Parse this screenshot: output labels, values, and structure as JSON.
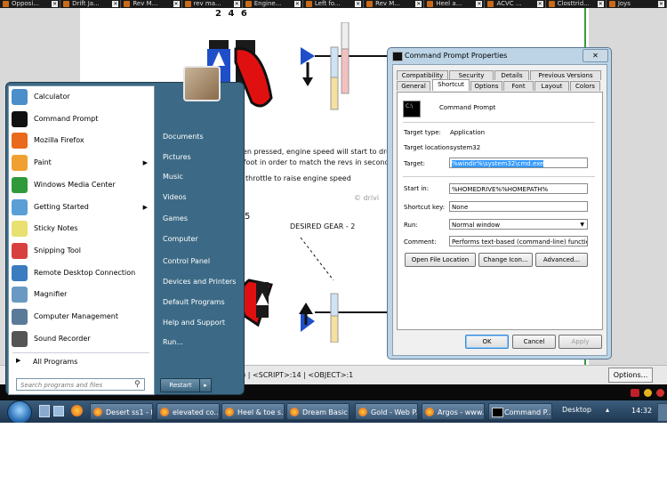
{
  "browser_tabs": [
    {
      "label": "Opposi..."
    },
    {
      "label": "Drift Ja..."
    },
    {
      "label": "Rev M..."
    },
    {
      "label": "rev ma..."
    },
    {
      "label": "Engine..."
    },
    {
      "label": "Left fo..."
    },
    {
      "label": "Rev M..."
    },
    {
      "label": "Heel a..."
    },
    {
      "label": "ACVC ..."
    },
    {
      "label": "Closttrid..."
    },
    {
      "label": "Joys"
    }
  ],
  "webpage": {
    "gear_numbers": "2 4 6",
    "para_line1": "een pressed, engine speed will start to dro",
    "para_line2": "t foot in order to match the revs in second g",
    "para_line3": "throttle to raise engine speed",
    "watermark": "© drivi",
    "desired_gear": "DESIRED GEAR - 2",
    "num_5": "5"
  },
  "statusbar": {
    "text": "t) | <SCRIPT>:14 | <OBJECT>:1",
    "options_label": "Options..."
  },
  "start_menu": {
    "left_items": [
      {
        "label": "Calculator",
        "icon": "calculator-icon",
        "color": "#4a8fc9",
        "arrow": false
      },
      {
        "label": "Command Prompt",
        "icon": "cmd-icon",
        "color": "#111111",
        "arrow": false
      },
      {
        "label": "Mozilla Firefox",
        "icon": "firefox-icon",
        "color": "#e86a1a",
        "arrow": false
      },
      {
        "label": "Paint",
        "icon": "paint-icon",
        "color": "#f0a030",
        "arrow": true
      },
      {
        "label": "Windows Media Center",
        "icon": "media-center-icon",
        "color": "#2f9a3a",
        "arrow": false
      },
      {
        "label": "Getting Started",
        "icon": "getting-started-icon",
        "color": "#5a9fd6",
        "arrow": true
      },
      {
        "label": "Sticky Notes",
        "icon": "sticky-notes-icon",
        "color": "#e8e070",
        "arrow": false
      },
      {
        "label": "Snipping Tool",
        "icon": "snipping-tool-icon",
        "color": "#d84040",
        "arrow": false
      },
      {
        "label": "Remote Desktop Connection",
        "icon": "remote-desktop-icon",
        "color": "#3a7cc0",
        "arrow": false
      },
      {
        "label": "Magnifier",
        "icon": "magnifier-icon",
        "color": "#6a9ac4",
        "arrow": false
      },
      {
        "label": "Computer Management",
        "icon": "computer-management-icon",
        "color": "#5a7a9a",
        "arrow": false
      },
      {
        "label": "Sound Recorder",
        "icon": "sound-recorder-icon",
        "color": "#555555",
        "arrow": false
      }
    ],
    "all_programs": "All Programs",
    "search_placeholder": "Search programs and files",
    "right_items": [
      {
        "label": "Documents"
      },
      {
        "label": "Pictures"
      },
      {
        "label": "Music"
      },
      {
        "label": "Videos"
      },
      {
        "label": "Games"
      },
      {
        "label": "Computer"
      },
      {
        "label": "Control Panel"
      },
      {
        "label": "Devices and Printers"
      },
      {
        "label": "Default Programs"
      },
      {
        "label": "Help and Support"
      },
      {
        "label": "Run..."
      }
    ],
    "restart_label": "Restart"
  },
  "dialog": {
    "title": "Command Prompt Properties",
    "tabs_row1": [
      "Compatibility",
      "Security",
      "Details",
      "Previous Versions"
    ],
    "tabs_row2": [
      "General",
      "Shortcut",
      "Options",
      "Font",
      "Layout",
      "Colors"
    ],
    "active_tab": "Shortcut",
    "app_name": "Command Prompt",
    "target_type_label": "Target type:",
    "target_type_value": "Application",
    "target_location_label": "Target location:",
    "target_location_value": "system32",
    "target_label": "Target:",
    "target_value": "%windir%\\system32\\cmd.exe",
    "start_in_label": "Start in:",
    "start_in_value": "%HOMEDRIVE%%HOMEPATH%",
    "shortcut_key_label": "Shortcut key:",
    "shortcut_key_value": "None",
    "run_label": "Run:",
    "run_value": "Normal window",
    "comment_label": "Comment:",
    "comment_value": "Performs text-based (command-line) functions.",
    "open_file_location": "Open File Location",
    "change_icon": "Change Icon...",
    "advanced": "Advanced...",
    "ok": "OK",
    "cancel": "Cancel",
    "apply": "Apply"
  },
  "taskbar": {
    "buttons": [
      {
        "label": "Desert ss1 - F...",
        "icon": "firefox-icon"
      },
      {
        "label": "elevated co...",
        "icon": "firefox-icon"
      },
      {
        "label": "Heel & toe s...",
        "icon": "firefox-icon"
      },
      {
        "label": "Dream Basic ...",
        "icon": "firefox-icon"
      },
      {
        "label": "Gold - Web P...",
        "icon": "firefox-icon"
      },
      {
        "label": "Argos - www...",
        "icon": "firefox-icon"
      },
      {
        "label": "Command P...",
        "icon": "cmd-icon"
      }
    ],
    "desktop_label": "Desktop",
    "clock": "14:32"
  }
}
